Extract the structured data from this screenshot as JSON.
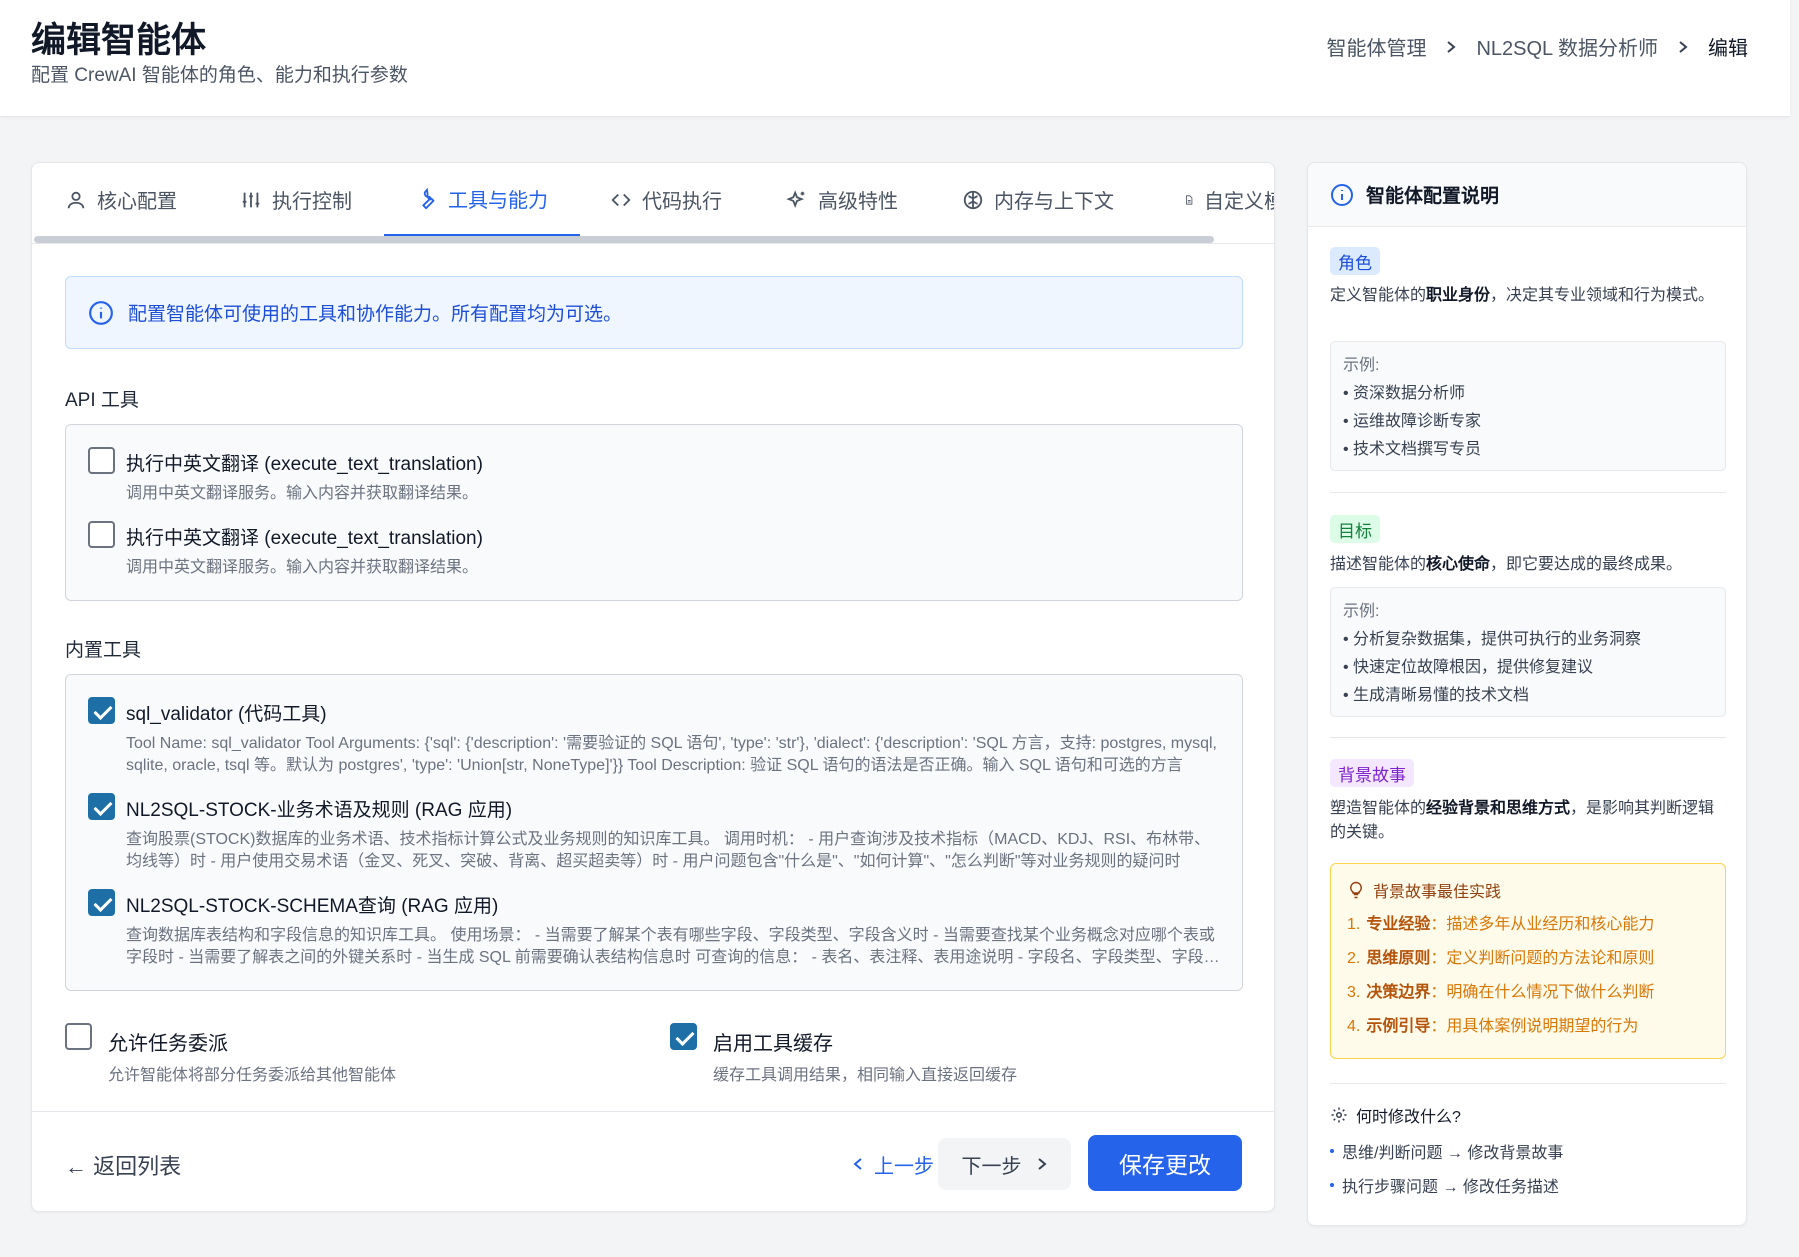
{
  "header": {
    "title": "编辑智能体",
    "subtitle": "配置 CrewAI 智能体的角色、能力和执行参数",
    "breadcrumb": [
      "智能体管理",
      "NL2SQL 数据分析师",
      "编辑"
    ]
  },
  "tabs": [
    {
      "label": "核心配置",
      "icon": "user-icon"
    },
    {
      "label": "执行控制",
      "icon": "sliders-icon"
    },
    {
      "label": "工具与能力",
      "icon": "wrench-icon",
      "active": true
    },
    {
      "label": "代码执行",
      "icon": "code-icon"
    },
    {
      "label": "高级特性",
      "icon": "sparkles-icon"
    },
    {
      "label": "内存与上下文",
      "icon": "brain-icon"
    },
    {
      "label": "自定义模",
      "icon": "file-icon"
    }
  ],
  "info_banner": "配置智能体可使用的工具和协作能力。所有配置均为可选。",
  "api_tools": {
    "label": "API 工具",
    "items": [
      {
        "name": "执行中英文翻译 (execute_text_translation)",
        "desc": "调用中英文翻译服务。输入内容并获取翻译结果。",
        "checked": false
      },
      {
        "name": "执行中英文翻译 (execute_text_translation)",
        "desc": "调用中英文翻译服务。输入内容并获取翻译结果。",
        "checked": false
      }
    ]
  },
  "builtin_tools": {
    "label": "内置工具",
    "items": [
      {
        "name": "sql_validator (代码工具)",
        "desc": "Tool Name: sql_validator Tool Arguments: {'sql': {'description': '需要验证的 SQL 语句', 'type': 'str'}, 'dialect': {'description': 'SQL 方言，支持: postgres, mysql, sqlite, oracle, tsql 等。默认为 postgres', 'type': 'Union[str, NoneType]'}} Tool Description: 验证 SQL 语句的语法是否正确。输入 SQL 语句和可选的方言",
        "checked": true
      },
      {
        "name": "NL2SQL-STOCK-业务术语及规则 (RAG 应用)",
        "desc": "查询股票(STOCK)数据库的业务术语、技术指标计算公式及业务规则的知识库工具。 调用时机：  - 用户查询涉及技术指标（MACD、KDJ、RSI、布林带、均线等）时 - 用户使用交易术语（金叉、死叉、突破、背离、超买超卖等）时 - 用户问题包含\"什么是\"、\"如何计算\"、\"怎么判断\"等对业务规则的疑问时",
        "checked": true
      },
      {
        "name": "NL2SQL-STOCK-SCHEMA查询 (RAG 应用)",
        "desc": "查询数据库表结构和字段信息的知识库工具。 使用场景：  - 当需要了解某个表有哪些字段、字段类型、字段含义时 - 当需要查找某个业务概念对应哪个表或字段时 - 当需要了解表之间的外键关系时 - 当生成 SQL 前需要确认表结构信息时 可查询的信息：  - 表名、表注释、表用途说明 - 字段名、字段类型、字段注释",
        "checked": true
      }
    ]
  },
  "options": [
    {
      "label": "允许任务委派",
      "desc": "允许智能体将部分任务委派给其他智能体",
      "checked": false
    },
    {
      "label": "启用工具缓存",
      "desc": "缓存工具调用结果，相同输入直接返回缓存",
      "checked": true
    }
  ],
  "footer": {
    "back": "← 返回列表",
    "prev": "上一步",
    "next": "下一步",
    "save": "保存更改"
  },
  "sidebar": {
    "title": "智能体配置说明",
    "role": {
      "tag": "角色",
      "desc_pre": "定义智能体的",
      "desc_bold": "职业身份",
      "desc_post": "，决定其专业领域和行为模式。",
      "example_title": "示例:",
      "examples": [
        "• 资深数据分析师",
        "• 运维故障诊断专家",
        "• 技术文档撰写专员"
      ]
    },
    "goal": {
      "tag": "目标",
      "desc_pre": "描述智能体的",
      "desc_bold": "核心使命",
      "desc_post": "，即它要达成的最终成果。",
      "example_title": "示例:",
      "examples": [
        "• 分析复杂数据集，提供可执行的业务洞察",
        "• 快速定位故障根因，提供修复建议",
        "• 生成清晰易懂的技术文档"
      ]
    },
    "backstory": {
      "tag": "背景故事",
      "desc_pre": "塑造智能体的",
      "desc_bold": "经验背景和思维方式",
      "desc_post": "，是影响其判断逻辑的关键。"
    },
    "best_practice": {
      "title": "背景故事最佳实践",
      "items": [
        {
          "num": "1.",
          "bold": "专业经验",
          "text": "：描述多年从业经历和核心能力"
        },
        {
          "num": "2.",
          "bold": "思维原则",
          "text": "：定义判断问题的方法论和原则"
        },
        {
          "num": "3.",
          "bold": "决策边界",
          "text": "：明确在什么情况下做什么判断"
        },
        {
          "num": "4.",
          "bold": "示例引导",
          "text": "：用具体案例说明期望的行为"
        }
      ]
    },
    "when": {
      "title": "何时修改什么?",
      "items": [
        "思维/判断问题 → 修改背景故事",
        "执行步骤问题 → 修改任务描述"
      ]
    }
  }
}
